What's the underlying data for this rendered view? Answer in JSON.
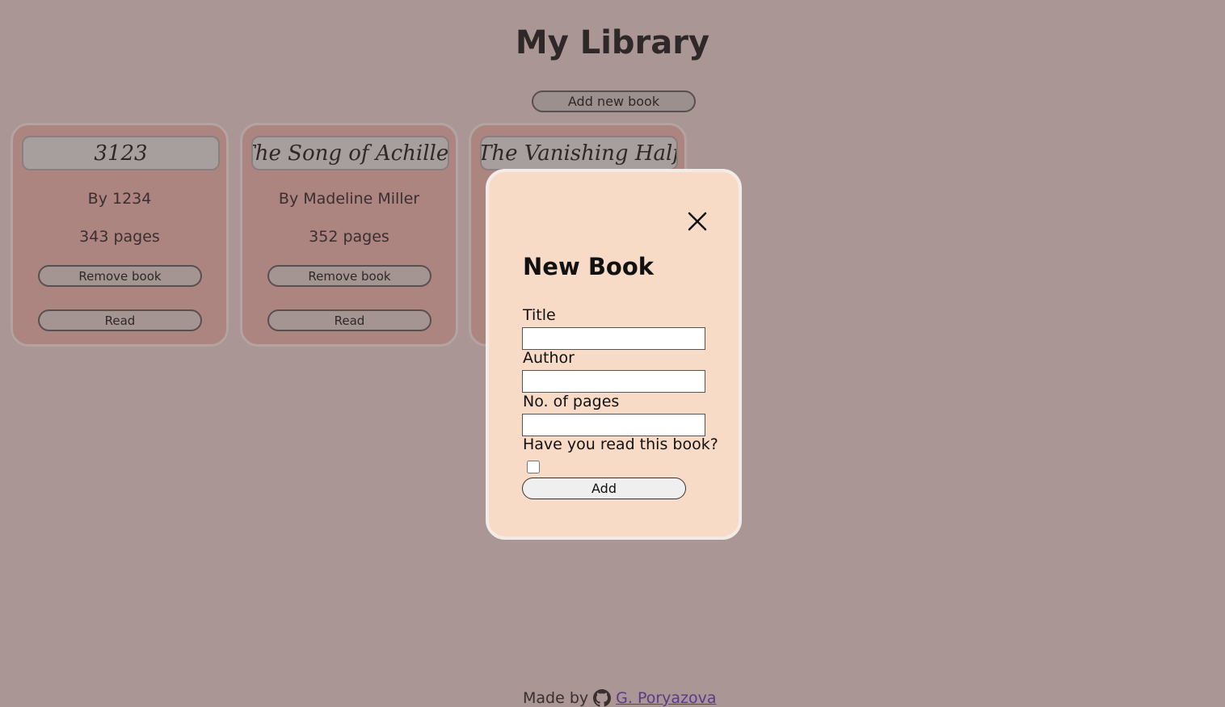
{
  "header": {
    "title": "My Library",
    "add_button_label": "Add new book"
  },
  "books": [
    {
      "title": "3123",
      "author": "By 1234",
      "pages": "343 pages",
      "remove_label": "Remove book",
      "status_label": "Read"
    },
    {
      "title": "The Song of Achilles",
      "author": "By Madeline Miller",
      "pages": "352 pages",
      "remove_label": "Remove book",
      "status_label": "Read"
    },
    {
      "title": "The Vanishing Half",
      "author": "",
      "pages": "",
      "remove_label": "",
      "status_label": ""
    }
  ],
  "modal": {
    "heading": "New Book",
    "close_icon": "close-icon",
    "fields": {
      "title_label": "Title",
      "author_label": "Author",
      "pages_label": "No. of pages",
      "read_label": "Have you read this book?"
    },
    "read_checked": false,
    "submit_label": "Add"
  },
  "footer": {
    "prefix": "Made by",
    "author_link": "G. Poryazova",
    "icon": "github-icon"
  },
  "colors": {
    "background": "#aa9694",
    "card": "#ad8580",
    "modal": "#f8dbc6",
    "link": "#5a3b86"
  }
}
